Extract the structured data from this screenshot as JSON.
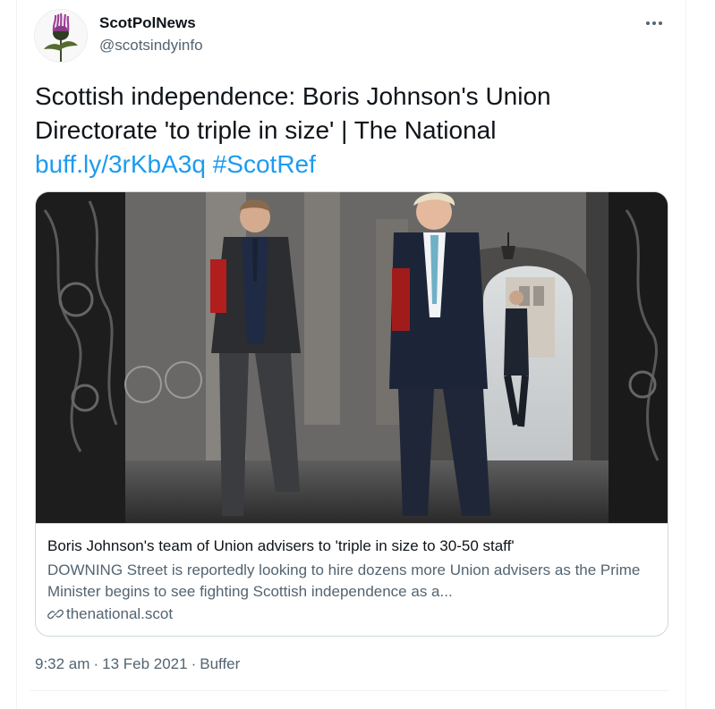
{
  "author": {
    "name": "ScotPolNews",
    "handle": "@scotsindyinfo"
  },
  "tweet": {
    "text": "Scottish independence: Boris Johnson's Union Directorate 'to triple in size' | The National",
    "link": "buff.ly/3rKbA3q",
    "hashtag": "#ScotRef"
  },
  "card": {
    "title": "Boris Johnson's team of Union advisers to 'triple in size to 30-50 staff'",
    "description": "DOWNING Street is reportedly looking to hire dozens more Union advisers as the Prime Minister begins to see fighting Scottish independence as a...",
    "domain": "thenational.scot"
  },
  "meta": {
    "time": "9:32 am",
    "date": "13 Feb 2021",
    "source": "Buffer",
    "separator": "·"
  },
  "icons": {
    "avatar": "thistle-icon",
    "more": "more-icon",
    "link": "link-icon"
  },
  "colors": {
    "link": "#1d9bf0",
    "secondary_text": "#536471",
    "border": "#cfd9de"
  }
}
